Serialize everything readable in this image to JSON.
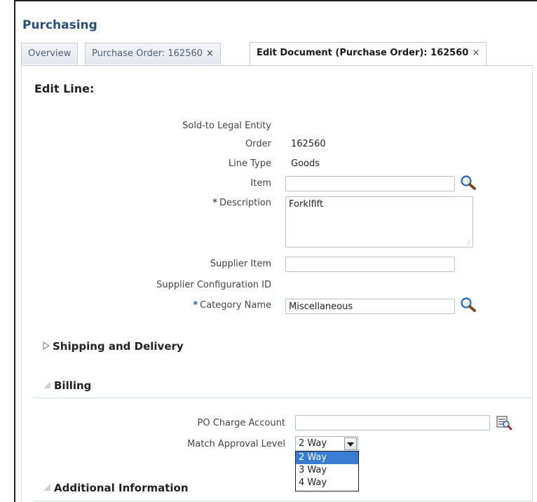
{
  "app": {
    "title": "Purchasing"
  },
  "tabs": [
    {
      "label": "Overview",
      "closable": false,
      "active": false
    },
    {
      "label": "Purchase Order: 162560",
      "closable": true,
      "active": false
    },
    {
      "label": "Edit Document (Purchase Order): 162560",
      "closable": true,
      "active": true
    }
  ],
  "close_glyph": "×",
  "edit_line": {
    "title": "Edit Line:",
    "fields": {
      "sold_to_legal_entity": {
        "label": "Sold-to Legal Entity",
        "value": ""
      },
      "order": {
        "label": "Order",
        "value": "162560"
      },
      "line_type": {
        "label": "Line Type",
        "value": "Goods"
      },
      "item": {
        "label": "Item",
        "value": ""
      },
      "description": {
        "label": "Description",
        "value": "Forklfift",
        "required": true
      },
      "supplier_item": {
        "label": "Supplier Item",
        "value": ""
      },
      "supplier_configuration_id": {
        "label": "Supplier Configuration ID",
        "value": ""
      },
      "category_name": {
        "label": "Category Name",
        "value": "Miscellaneous",
        "required": true
      }
    }
  },
  "required_marker": "*",
  "sections": {
    "shipping": {
      "title": "Shipping and Delivery",
      "expanded": false
    },
    "billing": {
      "title": "Billing",
      "expanded": true
    },
    "additional": {
      "title": "Additional Information",
      "expanded": true
    }
  },
  "billing": {
    "po_charge_account": {
      "label": "PO Charge Account",
      "value": ""
    },
    "match_approval_level": {
      "label": "Match Approval Level",
      "value": "2 Way",
      "options": [
        "2 Way",
        "3 Way",
        "4 Way"
      ],
      "highlighted": "2 Way"
    }
  },
  "colors": {
    "title_blue": "#2b4d7a",
    "required_blue": "#2f5a95",
    "selection_blue": "#3a7cd4"
  },
  "icons": [
    "search-icon",
    "account-lookup-icon",
    "expand-triangle-icon",
    "collapse-triangle-icon",
    "chevron-down-icon",
    "panel-toggle-icon"
  ]
}
